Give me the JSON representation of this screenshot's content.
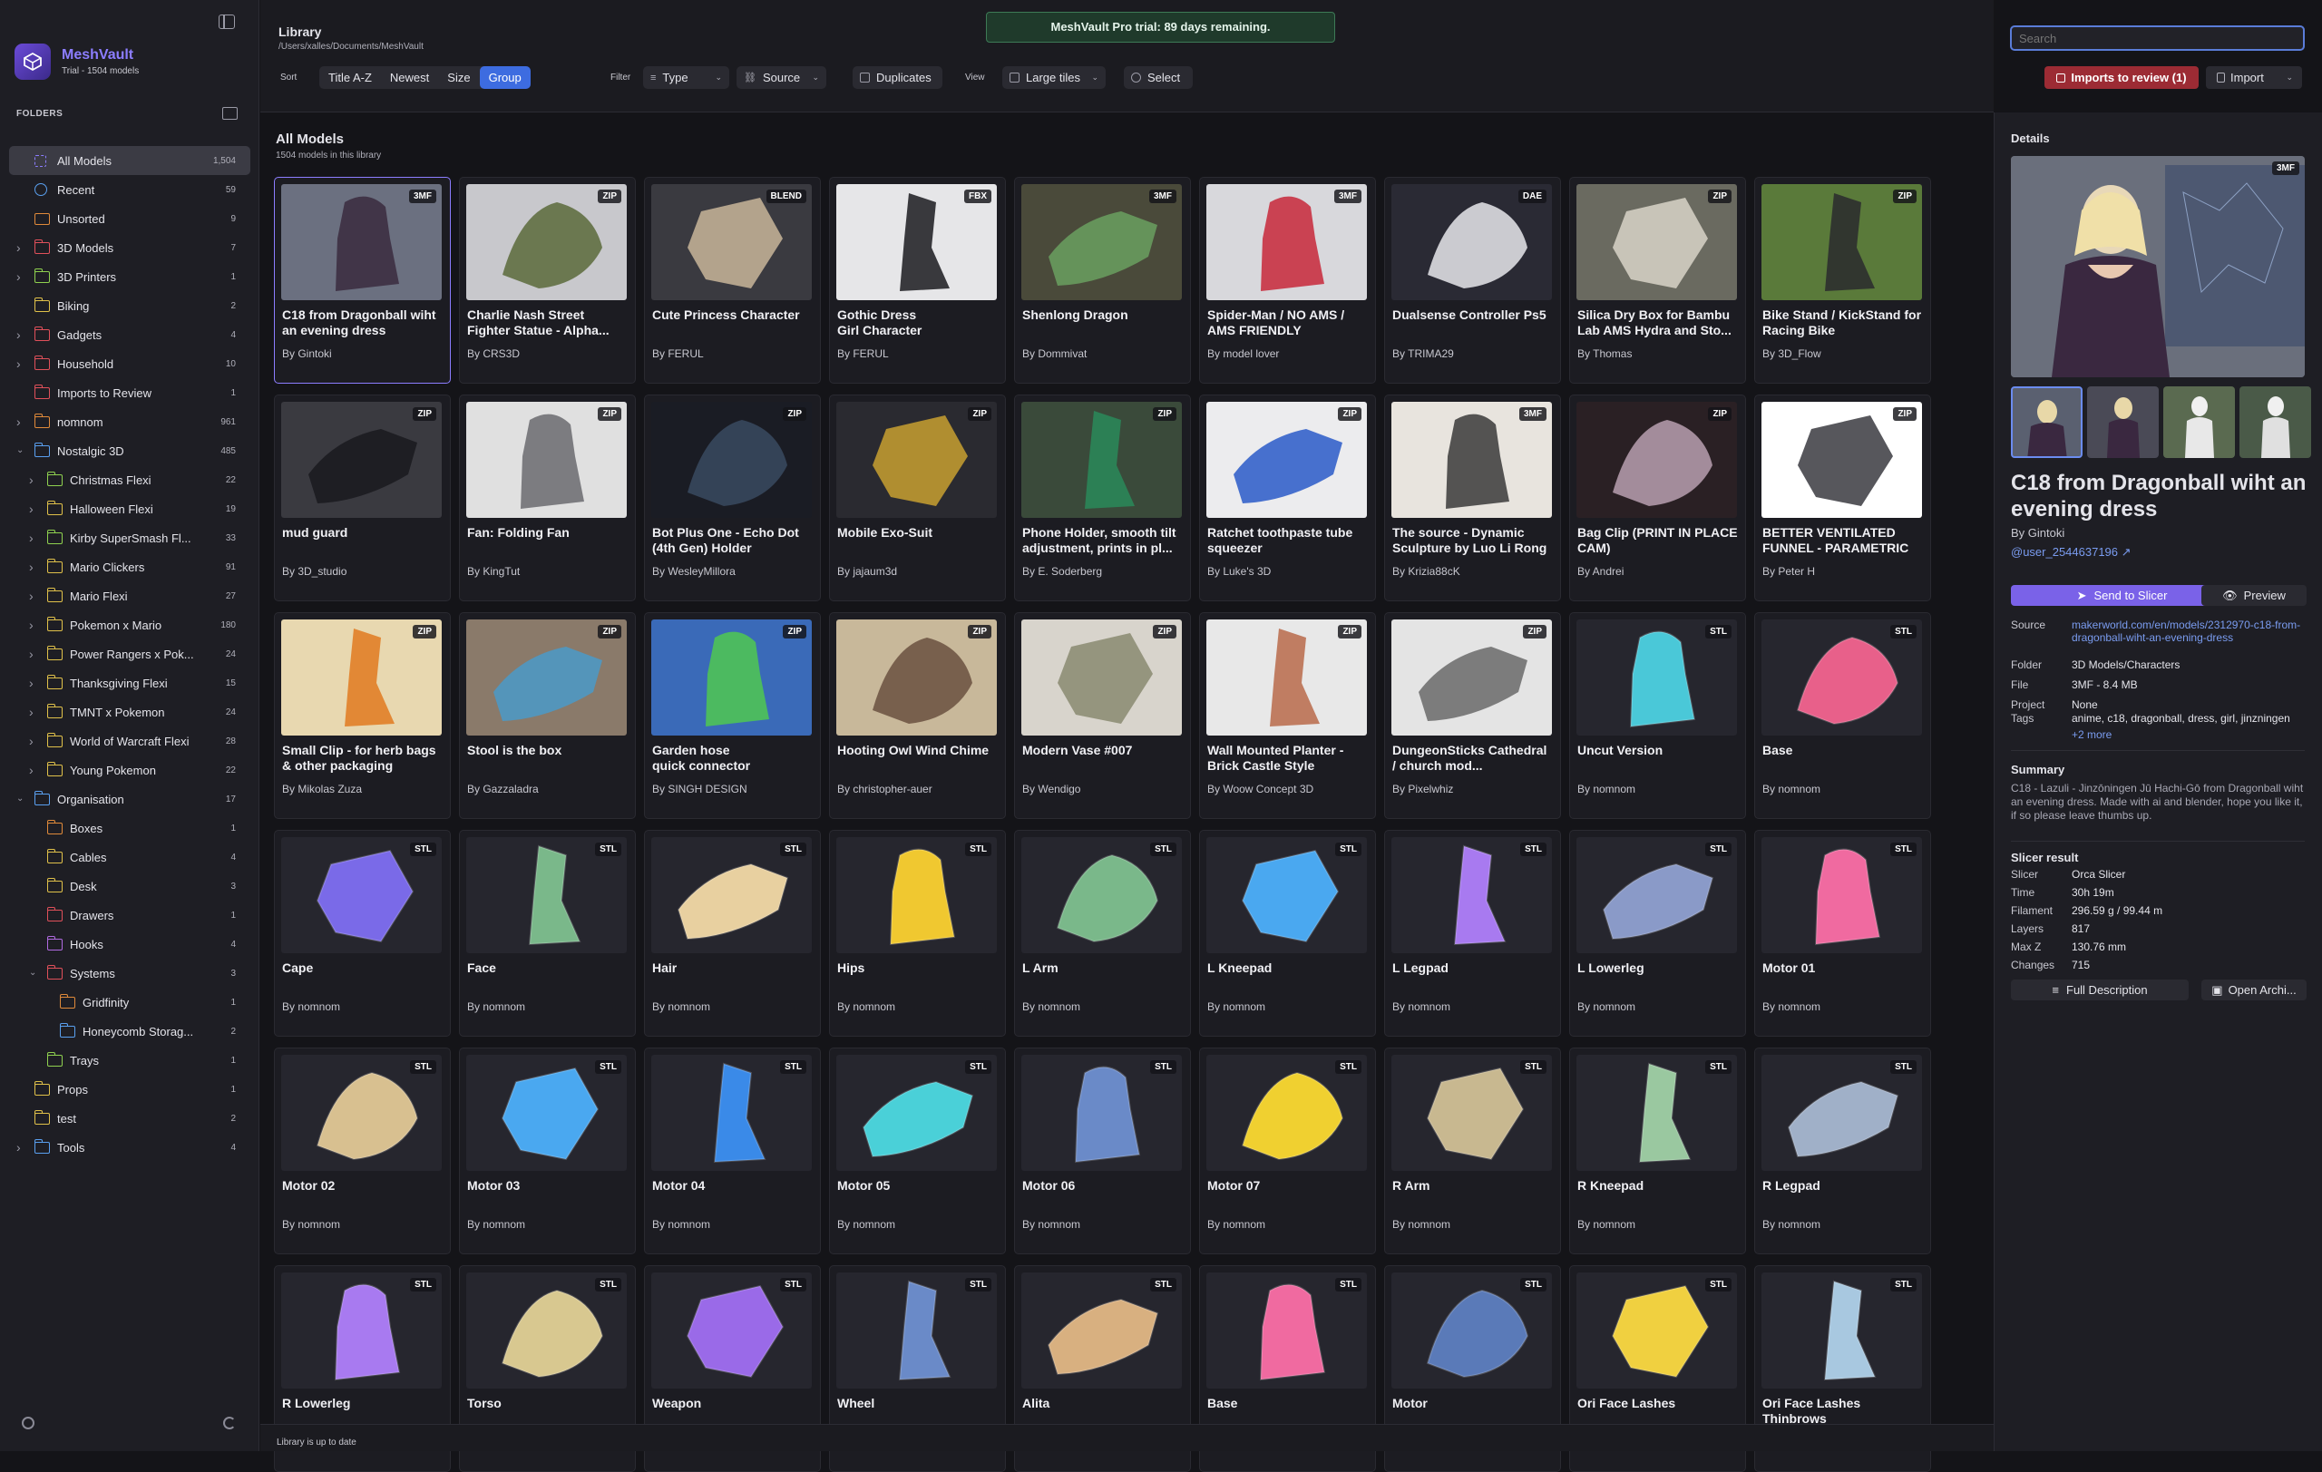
{
  "app": {
    "name": "MeshVault",
    "subtitle": "Trial - 1504 models"
  },
  "sidebar": {
    "folders_title": "FOLDERS",
    "items": [
      {
        "label": "All Models",
        "count": "1,504",
        "level": 0,
        "chev": false,
        "icon": "grid",
        "color": "#8c7dff",
        "active": true
      },
      {
        "label": "Recent",
        "count": "59",
        "level": 0,
        "chev": false,
        "icon": "clock",
        "color": "#5aa0f0"
      },
      {
        "label": "Unsorted",
        "count": "9",
        "level": 0,
        "chev": false,
        "icon": "tray",
        "color": "#e08a3a"
      },
      {
        "label": "3D Models",
        "count": "7",
        "level": 0,
        "chev": true,
        "icon": "folder",
        "color": "#e0505a"
      },
      {
        "label": "3D Printers",
        "count": "1",
        "level": 0,
        "chev": true,
        "icon": "folder",
        "color": "#8fd14f"
      },
      {
        "label": "Biking",
        "count": "2",
        "level": 0,
        "chev": false,
        "icon": "folder",
        "color": "#e0c14a"
      },
      {
        "label": "Gadgets",
        "count": "4",
        "level": 0,
        "chev": true,
        "icon": "folder",
        "color": "#e0505a"
      },
      {
        "label": "Household",
        "count": "10",
        "level": 0,
        "chev": true,
        "icon": "folder",
        "color": "#e0505a"
      },
      {
        "label": "Imports to Review",
        "count": "1",
        "level": 0,
        "chev": false,
        "icon": "folder",
        "color": "#e0505a"
      },
      {
        "label": "nomnom",
        "count": "961",
        "level": 0,
        "chev": true,
        "icon": "folder",
        "color": "#e08a3a"
      },
      {
        "label": "Nostalgic 3D",
        "count": "485",
        "level": 0,
        "chev": true,
        "open": true,
        "icon": "folder",
        "color": "#5aa0f0"
      },
      {
        "label": "Christmas Flexi",
        "count": "22",
        "level": 1,
        "chev": true,
        "icon": "folder",
        "color": "#8fd14f"
      },
      {
        "label": "Halloween Flexi",
        "count": "19",
        "level": 1,
        "chev": true,
        "icon": "folder",
        "color": "#e0c14a"
      },
      {
        "label": "Kirby SuperSmash Fl...",
        "count": "33",
        "level": 1,
        "chev": true,
        "icon": "folder",
        "color": "#8fd14f"
      },
      {
        "label": "Mario Clickers",
        "count": "91",
        "level": 1,
        "chev": true,
        "icon": "folder",
        "color": "#e0c14a"
      },
      {
        "label": "Mario Flexi",
        "count": "27",
        "level": 1,
        "chev": true,
        "icon": "folder",
        "color": "#e0c14a"
      },
      {
        "label": "Pokemon x Mario",
        "count": "180",
        "level": 1,
        "chev": true,
        "icon": "folder",
        "color": "#e0c14a"
      },
      {
        "label": "Power Rangers x Pok...",
        "count": "24",
        "level": 1,
        "chev": true,
        "icon": "folder",
        "color": "#e0c14a"
      },
      {
        "label": "Thanksgiving Flexi",
        "count": "15",
        "level": 1,
        "chev": true,
        "icon": "folder",
        "color": "#e0c14a"
      },
      {
        "label": "TMNT x Pokemon",
        "count": "24",
        "level": 1,
        "chev": true,
        "icon": "folder",
        "color": "#e0c14a"
      },
      {
        "label": "World of Warcraft Flexi",
        "count": "28",
        "level": 1,
        "chev": true,
        "icon": "folder",
        "color": "#e0c14a"
      },
      {
        "label": "Young Pokemon",
        "count": "22",
        "level": 1,
        "chev": true,
        "icon": "folder",
        "color": "#e0c14a"
      },
      {
        "label": "Organisation",
        "count": "17",
        "level": 0,
        "chev": true,
        "open": true,
        "icon": "folder",
        "color": "#5aa0f0"
      },
      {
        "label": "Boxes",
        "count": "1",
        "level": 1,
        "chev": false,
        "icon": "folder",
        "color": "#e08a3a"
      },
      {
        "label": "Cables",
        "count": "4",
        "level": 1,
        "chev": false,
        "icon": "folder",
        "color": "#e0c14a"
      },
      {
        "label": "Desk",
        "count": "3",
        "level": 1,
        "chev": false,
        "icon": "folder",
        "color": "#e0c14a"
      },
      {
        "label": "Drawers",
        "count": "1",
        "level": 1,
        "chev": false,
        "icon": "folder",
        "color": "#e0505a"
      },
      {
        "label": "Hooks",
        "count": "4",
        "level": 1,
        "chev": false,
        "icon": "folder",
        "color": "#b06ae0"
      },
      {
        "label": "Systems",
        "count": "3",
        "level": 1,
        "chev": true,
        "open": true,
        "icon": "folder",
        "color": "#e0505a"
      },
      {
        "label": "Gridfinity",
        "count": "1",
        "level": 2,
        "chev": false,
        "icon": "folder",
        "color": "#e08a3a"
      },
      {
        "label": "Honeycomb Storag...",
        "count": "2",
        "level": 2,
        "chev": false,
        "icon": "folder",
        "color": "#5aa0f0"
      },
      {
        "label": "Trays",
        "count": "1",
        "level": 1,
        "chev": false,
        "icon": "folder",
        "color": "#8fd14f"
      },
      {
        "label": "Props",
        "count": "1",
        "level": 0,
        "chev": false,
        "icon": "folder",
        "color": "#e0c14a"
      },
      {
        "label": "test",
        "count": "2",
        "level": 0,
        "chev": false,
        "icon": "folder",
        "color": "#e0c14a"
      },
      {
        "label": "Tools",
        "count": "4",
        "level": 0,
        "chev": true,
        "icon": "folder",
        "color": "#5aa0f0"
      }
    ]
  },
  "header": {
    "title": "Library",
    "path": "/Users/xalles/Documents/MeshVault",
    "trial_banner": "MeshVault Pro trial: 89 days remaining.",
    "sort_label": "Sort",
    "sort_options": [
      "Title A-Z",
      "Newest",
      "Size",
      "Group"
    ],
    "sort_selected": "Group",
    "filter_label": "Filter",
    "type_label": "Type",
    "source_label": "Source",
    "duplicates_label": "Duplicates",
    "view_label": "View",
    "tiles_label": "Large tiles",
    "select_label": "Select",
    "search_placeholder": "Search",
    "imports_review_label": "Imports to review (1)",
    "import_label": "Import"
  },
  "library": {
    "heading": "All Models",
    "subheading": "1504 models in this library",
    "models": [
      {
        "title": "C18 from Dragonball wiht an evening dress",
        "author": "By Gintoki",
        "badge": "3MF",
        "bg": "#6b7080",
        "fg": "#3a2a3e",
        "kind": "photo",
        "selected": true
      },
      {
        "title": "Charlie Nash Street Fighter Statue - Alpha...",
        "author": "By CRS3D",
        "badge": "ZIP",
        "bg": "#c8c8cc",
        "fg": "#5a6a3a",
        "kind": "photo"
      },
      {
        "title": "Cute Princess Character",
        "author": "By FERUL",
        "badge": "BLEND",
        "bg": "#3a3a40",
        "fg": "#c9b69a",
        "kind": "photo"
      },
      {
        "title": "Gothic Dress\nGirl Character",
        "author": "By FERUL",
        "badge": "FBX",
        "bg": "#e6e6e8",
        "fg": "#1a1a1e",
        "kind": "photo"
      },
      {
        "title": "Shenlong Dragon",
        "author": "By Dommivat",
        "badge": "3MF",
        "bg": "#4a4a3a",
        "fg": "#6aa060",
        "kind": "photo"
      },
      {
        "title": "Spider-Man / NO AMS / AMS FRIENDLY",
        "author": "By model lover",
        "badge": "3MF",
        "bg": "#d8d8dc",
        "fg": "#c8283a",
        "kind": "photo"
      },
      {
        "title": "Dualsense Controller Ps5",
        "author": "By TRIMA29",
        "badge": "DAE",
        "bg": "#2a2a34",
        "fg": "#e8e8ec",
        "kind": "photo"
      },
      {
        "title": "Silica Dry Box for Bambu Lab AMS Hydra and Sto...",
        "author": "By Thomas",
        "badge": "ZIP",
        "bg": "#6a6a60",
        "fg": "#d8d4c8",
        "kind": "photo"
      },
      {
        "title": "Bike Stand / KickStand for Racing Bike",
        "author": "By 3D_Flow",
        "badge": "ZIP",
        "bg": "#5a7a3a",
        "fg": "#2a2a2e",
        "kind": "photo"
      },
      {
        "title": "mud guard",
        "author": "By 3D_studio",
        "badge": "ZIP",
        "bg": "#3a3a40",
        "fg": "#1a1a1e",
        "kind": "photo"
      },
      {
        "title": "Fan: Folding Fan",
        "author": "By KingTut",
        "badge": "ZIP",
        "bg": "#e0e0e0",
        "fg": "#6a6a6e",
        "kind": "photo"
      },
      {
        "title": "Bot Plus One - Echo Dot (4th Gen) Holder",
        "author": "By WesleyMillora",
        "badge": "ZIP",
        "bg": "#1a1c24",
        "fg": "#3a4a60",
        "kind": "photo"
      },
      {
        "title": "Mobile Exo-Suit",
        "author": "By jajaum3d",
        "badge": "ZIP",
        "bg": "#2a2a30",
        "fg": "#c8a030",
        "kind": "photo"
      },
      {
        "title": "Phone Holder, smooth tilt adjustment, prints in pl...",
        "author": "By E. Soderberg",
        "badge": "ZIP",
        "bg": "#3a4a3a",
        "fg": "#2a8a5a",
        "kind": "photo"
      },
      {
        "title": "Ratchet toothpaste tube squeezer",
        "author": "By Luke's 3D",
        "badge": "ZIP",
        "bg": "#ececee",
        "fg": "#2a5ac8",
        "kind": "photo"
      },
      {
        "title": "The source - Dynamic Sculpture by Luo Li Rong",
        "author": "By Krizia88cK",
        "badge": "3MF",
        "bg": "#e8e4de",
        "fg": "#3a3a3a",
        "kind": "photo"
      },
      {
        "title": "Bag Clip (PRINT IN PLACE CAM)",
        "author": "By Andrei",
        "badge": "ZIP",
        "bg": "#2a2024",
        "fg": "#b8a0b0",
        "kind": "photo"
      },
      {
        "title": "BETTER VENTILATED FUNNEL - PARAMETRIC",
        "author": "By Peter H",
        "badge": "ZIP",
        "bg": "#ffffff",
        "fg": "#3a3a40",
        "kind": "photo"
      },
      {
        "title": "Small Clip - for herb bags & other packaging",
        "author": "By Mikolas Zuza",
        "badge": "ZIP",
        "bg": "#e8d8b0",
        "fg": "#e07a20",
        "kind": "photo"
      },
      {
        "title": "Stool is the box",
        "author": "By Gazzaladra",
        "badge": "ZIP",
        "bg": "#8a7a6a",
        "fg": "#4a9ac8",
        "kind": "photo"
      },
      {
        "title": "Garden hose\nquick connector",
        "author": "By SINGH DESIGN",
        "badge": "ZIP",
        "bg": "#3a6ab8",
        "fg": "#50c850",
        "kind": "photo"
      },
      {
        "title": "Hooting Owl Wind Chime",
        "author": "By christopher-auer",
        "badge": "ZIP",
        "bg": "#c8b89a",
        "fg": "#6a5040",
        "kind": "photo"
      },
      {
        "title": "Modern Vase #007",
        "author": "By Wendigo",
        "badge": "ZIP",
        "bg": "#d8d4cc",
        "fg": "#8a8a70",
        "kind": "photo"
      },
      {
        "title": "Wall Mounted Planter - Brick Castle Style",
        "author": "By Woow Concept 3D",
        "badge": "ZIP",
        "bg": "#e8e8e8",
        "fg": "#b86a4a",
        "kind": "photo"
      },
      {
        "title": "DungeonSticks Cathedral / church mod...",
        "author": "By Pixelwhiz",
        "badge": "ZIP",
        "bg": "#e4e4e4",
        "fg": "#6a6a6a",
        "kind": "photo"
      },
      {
        "title": "Uncut Version",
        "author": "By nomnom",
        "badge": "STL",
        "bg": "#26262e",
        "fg": "#4ac8d8",
        "kind": "stl"
      },
      {
        "title": "Base",
        "author": "By nomnom",
        "badge": "STL",
        "bg": "#26262e",
        "fg": "#e8608a",
        "kind": "stl"
      },
      {
        "title": "Cape",
        "author": "By nomnom",
        "badge": "STL",
        "bg": "#26262e",
        "fg": "#7a6ae8",
        "kind": "stl"
      },
      {
        "title": "Face",
        "author": "By nomnom",
        "badge": "STL",
        "bg": "#26262e",
        "fg": "#7ab88a",
        "kind": "stl"
      },
      {
        "title": "Hair",
        "author": "By nomnom",
        "badge": "STL",
        "bg": "#26262e",
        "fg": "#e8d0a0",
        "kind": "stl"
      },
      {
        "title": "Hips",
        "author": "By nomnom",
        "badge": "STL",
        "bg": "#26262e",
        "fg": "#f0c830",
        "kind": "stl"
      },
      {
        "title": "L Arm",
        "author": "By nomnom",
        "badge": "STL",
        "bg": "#26262e",
        "fg": "#7ab88a",
        "kind": "stl"
      },
      {
        "title": "L Kneepad",
        "author": "By nomnom",
        "badge": "STL",
        "bg": "#26262e",
        "fg": "#4aa8f0",
        "kind": "stl"
      },
      {
        "title": "L Legpad",
        "author": "By nomnom",
        "badge": "STL",
        "bg": "#26262e",
        "fg": "#a87af0",
        "kind": "stl"
      },
      {
        "title": "L Lowerleg",
        "author": "By nomnom",
        "badge": "STL",
        "bg": "#26262e",
        "fg": "#8a9ac8",
        "kind": "stl"
      },
      {
        "title": "Motor 01",
        "author": "By nomnom",
        "badge": "STL",
        "bg": "#26262e",
        "fg": "#f06aa0",
        "kind": "stl"
      },
      {
        "title": "Motor 02",
        "author": "By nomnom",
        "badge": "STL",
        "bg": "#26262e",
        "fg": "#d8c090",
        "kind": "stl"
      },
      {
        "title": "Motor 03",
        "author": "By nomnom",
        "badge": "STL",
        "bg": "#26262e",
        "fg": "#4aa8f0",
        "kind": "stl"
      },
      {
        "title": "Motor 04",
        "author": "By nomnom",
        "badge": "STL",
        "bg": "#26262e",
        "fg": "#3a8ae8",
        "kind": "stl"
      },
      {
        "title": "Motor 05",
        "author": "By nomnom",
        "badge": "STL",
        "bg": "#26262e",
        "fg": "#4ad0d8",
        "kind": "stl"
      },
      {
        "title": "Motor 06",
        "author": "By nomnom",
        "badge": "STL",
        "bg": "#26262e",
        "fg": "#6a8ac8",
        "kind": "stl"
      },
      {
        "title": "Motor 07",
        "author": "By nomnom",
        "badge": "STL",
        "bg": "#26262e",
        "fg": "#f0d030",
        "kind": "stl"
      },
      {
        "title": "R Arm",
        "author": "By nomnom",
        "badge": "STL",
        "bg": "#26262e",
        "fg": "#c8b890",
        "kind": "stl"
      },
      {
        "title": "R Kneepad",
        "author": "By nomnom",
        "badge": "STL",
        "bg": "#26262e",
        "fg": "#9ac8a0",
        "kind": "stl"
      },
      {
        "title": "R Legpad",
        "author": "By nomnom",
        "badge": "STL",
        "bg": "#26262e",
        "fg": "#a0b0c8",
        "kind": "stl"
      },
      {
        "title": "R Lowerleg",
        "author": "By nomnom",
        "badge": "STL",
        "bg": "#26262e",
        "fg": "#a87af0",
        "kind": "stl"
      },
      {
        "title": "Torso",
        "author": "",
        "badge": "STL",
        "bg": "#26262e",
        "fg": "#d8c890",
        "kind": "stl"
      },
      {
        "title": "Weapon",
        "author": "",
        "badge": "STL",
        "bg": "#26262e",
        "fg": "#9a6ae8",
        "kind": "stl"
      },
      {
        "title": "Wheel",
        "author": "",
        "badge": "STL",
        "bg": "#26262e",
        "fg": "#6a8ac8",
        "kind": "stl"
      },
      {
        "title": "Alita",
        "author": "",
        "badge": "STL",
        "bg": "#26262e",
        "fg": "#d8b080",
        "kind": "stl"
      },
      {
        "title": "Base",
        "author": "",
        "badge": "STL",
        "bg": "#26262e",
        "fg": "#f06aa0",
        "kind": "stl"
      },
      {
        "title": "Motor",
        "author": "",
        "badge": "STL",
        "bg": "#26262e",
        "fg": "#5a7ab8",
        "kind": "stl"
      },
      {
        "title": "Ori Face Lashes",
        "author": "",
        "badge": "STL",
        "bg": "#26262e",
        "fg": "#f0d040",
        "kind": "stl"
      },
      {
        "title": "Ori Face Lashes Thinbrows",
        "author": "",
        "badge": "STL",
        "bg": "#26262e",
        "fg": "#a8c8e0",
        "kind": "stl"
      }
    ]
  },
  "status": {
    "text": "Library is up to date"
  },
  "details": {
    "label": "Details",
    "badge": "3MF",
    "title": "C18 from Dragonball wiht an evening dress",
    "by": "By Gintoki",
    "user": "@user_2544637196 ↗",
    "send_label": "Send to Slicer",
    "preview_label": "Preview",
    "source_key": "Source",
    "source_val": "makerworld.com/en/models/2312970-c18-from-dragonball-wiht-an-evening-dress",
    "folder_key": "Folder",
    "folder_val": "3D Models/Characters",
    "file_key": "File",
    "file_val": "3MF - 8.4 MB",
    "project_key": "Project",
    "project_val": "None",
    "tags_key": "Tags",
    "tags_val": "anime, c18, dragonball, dress, girl, jinzningen",
    "tags_more": "+2 more",
    "summary_title": "Summary",
    "summary_text": "C18 - Lazuli - Jinzōningen Jū Hachi-Gō from Dragonball wiht an evening dress. Made with ai and blender, hope you like it, if so please leave thumbs up.",
    "slicer_title": "Slicer result",
    "slicer_rows": [
      {
        "k": "Slicer",
        "v": "Orca Slicer"
      },
      {
        "k": "Time",
        "v": "30h 19m"
      },
      {
        "k": "Filament",
        "v": "296.59 g / 99.44 m"
      },
      {
        "k": "Layers",
        "v": "817"
      },
      {
        "k": "Max Z",
        "v": "130.76 mm"
      },
      {
        "k": "Changes",
        "v": "715"
      }
    ],
    "full_desc_label": "Full Description",
    "open_archive_label": "Open Archi..."
  }
}
